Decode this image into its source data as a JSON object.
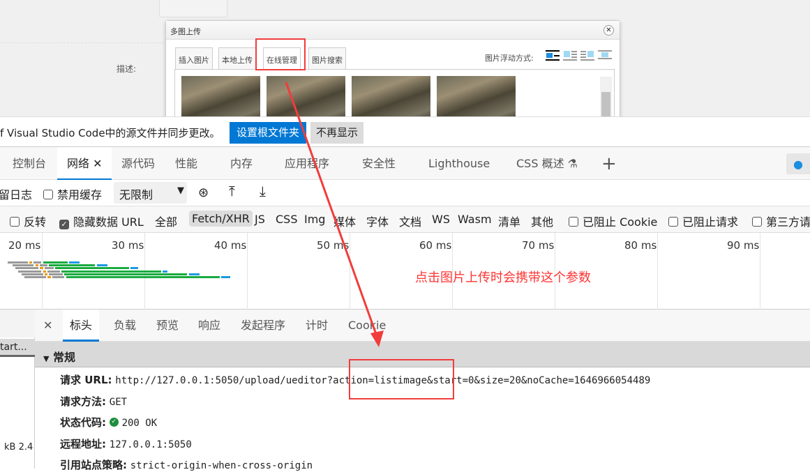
{
  "page": {
    "description_label": "描述:",
    "dialog": {
      "title": "多图上传",
      "close_icon": "close-icon",
      "tabs": [
        "插入图片",
        "本地上传",
        "在线管理",
        "图片搜索"
      ],
      "active_tab": "在线管理",
      "float_label": "图片浮动方式:",
      "float_options": [
        "none",
        "left",
        "right",
        "center"
      ]
    }
  },
  "notification": {
    "text": "f Visual Studio Code中的源文件并同步更改。",
    "primary_button": "设置根文件夹",
    "secondary_button": "不再显示"
  },
  "devtools": {
    "tabs": [
      "控制台",
      "网络",
      "源代码",
      "性能",
      "内存",
      "应用程序",
      "安全性",
      "Lighthouse",
      "CSS 概述"
    ],
    "active_tab": "网络",
    "toolbar": {
      "preserve_log": "留日志",
      "disable_cache": "禁用缓存",
      "throttle": "无限制"
    },
    "filters": {
      "invert": "反转",
      "hide_data_url": "隐藏数据 URL",
      "types": [
        "全部",
        "Fetch/XHR",
        "JS",
        "CSS",
        "Img",
        "媒体",
        "字体",
        "文档",
        "WS",
        "Wasm",
        "清单",
        "其他"
      ],
      "active_type": "Fetch/XHR",
      "blocked_cookies": "已阻止 Cookie",
      "blocked_requests": "已阻止请求",
      "third_party": "第三方请"
    },
    "timeline_ticks": [
      "20 ms",
      "30 ms",
      "40 ms",
      "50 ms",
      "60 ms",
      "70 ms",
      "80 ms",
      "90 ms"
    ],
    "annotation": "点击图片上传时会携带这个参数",
    "request_list": {
      "name_fragment": "tart...",
      "size_fragment": "kB  2.4"
    },
    "details": {
      "tabs": [
        "标头",
        "负载",
        "预览",
        "响应",
        "发起程序",
        "计时",
        "Cookie"
      ],
      "active_tab": "标头",
      "section": "常规",
      "rows": [
        {
          "label": "请求 URL:",
          "value": "http://127.0.0.1:5050/upload/ueditor?action=listimage&start=0&size=20&noCache=1646966054489"
        },
        {
          "label": "请求方法:",
          "value": "GET"
        },
        {
          "label": "状态代码:",
          "value": "200 OK"
        },
        {
          "label": "远程地址:",
          "value": "127.0.0.1:5050"
        },
        {
          "label": "引用站点策略:",
          "value": "strict-origin-when-cross-origin"
        }
      ]
    }
  },
  "colors": {
    "accent": "#0078d4",
    "annotation": "#ff3333",
    "waterfall_green": "#1aab40",
    "waterfall_blue": "#1a9ae0",
    "waterfall_orange": "#e89a0c"
  }
}
